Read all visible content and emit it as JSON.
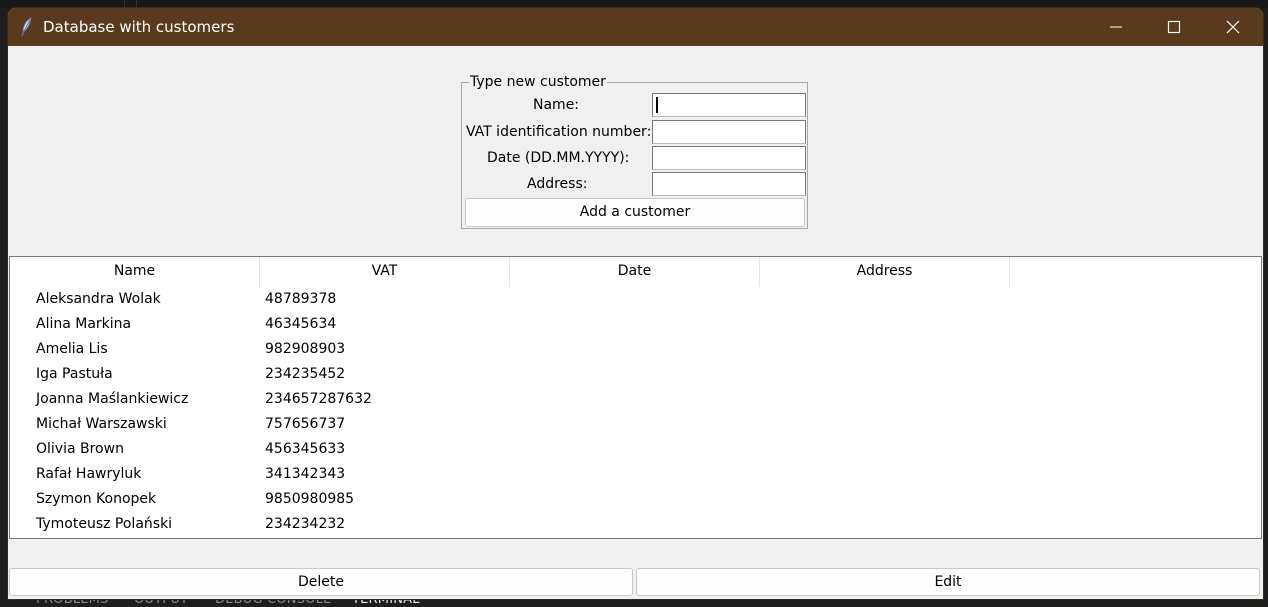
{
  "window": {
    "title": "Database with customers",
    "title_bar_color": "#5a3a1c",
    "controls": [
      "minimize-icon",
      "maximize-icon",
      "close-icon"
    ]
  },
  "form": {
    "legend": "Type new customer",
    "fields": {
      "name_label": "Name:",
      "vat_label": "VAT identification number:",
      "date_label": "Date (DD.MM.YYYY):",
      "address_label": "Address:"
    },
    "values": {
      "name": "",
      "vat": "",
      "date": "",
      "address": ""
    },
    "add_button": "Add a customer"
  },
  "table": {
    "columns": [
      "Name",
      "VAT",
      "Date",
      "Address"
    ],
    "rows": [
      {
        "name": "Aleksandra Wolak",
        "vat": "48789378",
        "date": "",
        "address": ""
      },
      {
        "name": "Alina Markina",
        "vat": "46345634",
        "date": "",
        "address": ""
      },
      {
        "name": "Amelia Lis",
        "vat": "982908903",
        "date": "",
        "address": ""
      },
      {
        "name": "Iga Pastuła",
        "vat": "234235452",
        "date": "",
        "address": ""
      },
      {
        "name": "Joanna Maślankiewicz",
        "vat": "234657287632",
        "date": "",
        "address": ""
      },
      {
        "name": "Michał Warszawski",
        "vat": "757656737",
        "date": "",
        "address": ""
      },
      {
        "name": "Olivia Brown",
        "vat": "456345633",
        "date": "",
        "address": ""
      },
      {
        "name": "Rafał Hawryluk",
        "vat": "341342343",
        "date": "",
        "address": ""
      },
      {
        "name": "Szymon Konopek",
        "vat": "9850980985",
        "date": "",
        "address": ""
      },
      {
        "name": "Tymoteusz Polański",
        "vat": "234234232",
        "date": "",
        "address": ""
      }
    ]
  },
  "actions": {
    "delete": "Delete",
    "edit": "Edit"
  },
  "background_panel": {
    "tabs": [
      "PROBLEMS",
      "OUTPUT",
      "DEBUG CONSOLE",
      "TERMINAL"
    ],
    "active_tab": "TERMINAL"
  }
}
